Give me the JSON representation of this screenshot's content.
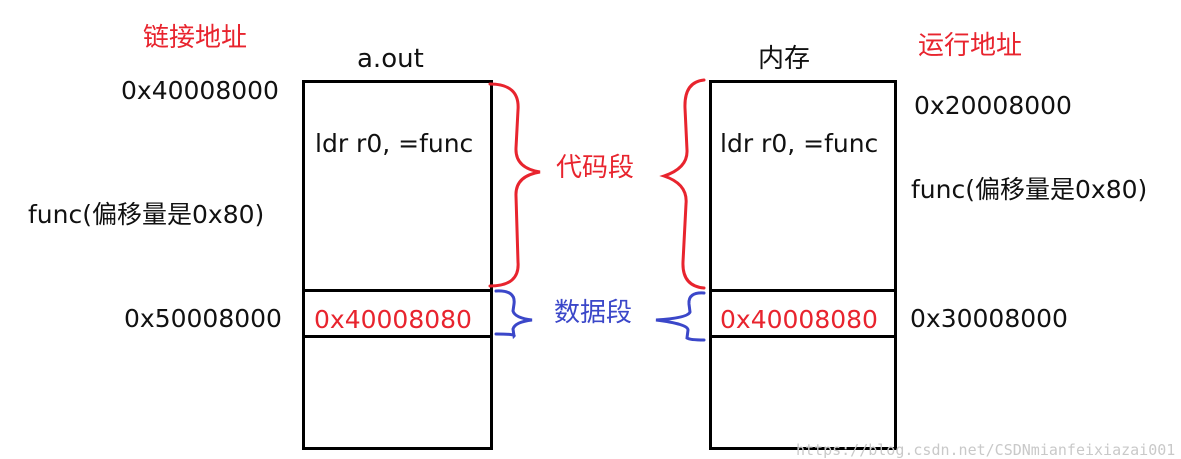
{
  "left": {
    "heading": "链接地址",
    "title": "a.out",
    "code_start_addr": "0x40008000",
    "func_label": "func(偏移量是0x80)",
    "data_start_addr": "0x50008000",
    "code_instruction": "ldr r0, =func",
    "data_value": "0x40008080"
  },
  "right": {
    "heading": "运行地址",
    "title": "内存",
    "code_start_addr": "0x20008000",
    "func_label": "func(偏移量是0x80)",
    "data_start_addr": "0x30008000",
    "code_instruction": "ldr r0, =func",
    "data_value": "0x40008080"
  },
  "segments": {
    "code": "代码段",
    "data": "数据段"
  },
  "colors": {
    "red": "#e8242e",
    "blue": "#3b47c9",
    "line": "#000000"
  },
  "watermark": "https://blog.csdn.net/CSDNmianfeixiazai001"
}
